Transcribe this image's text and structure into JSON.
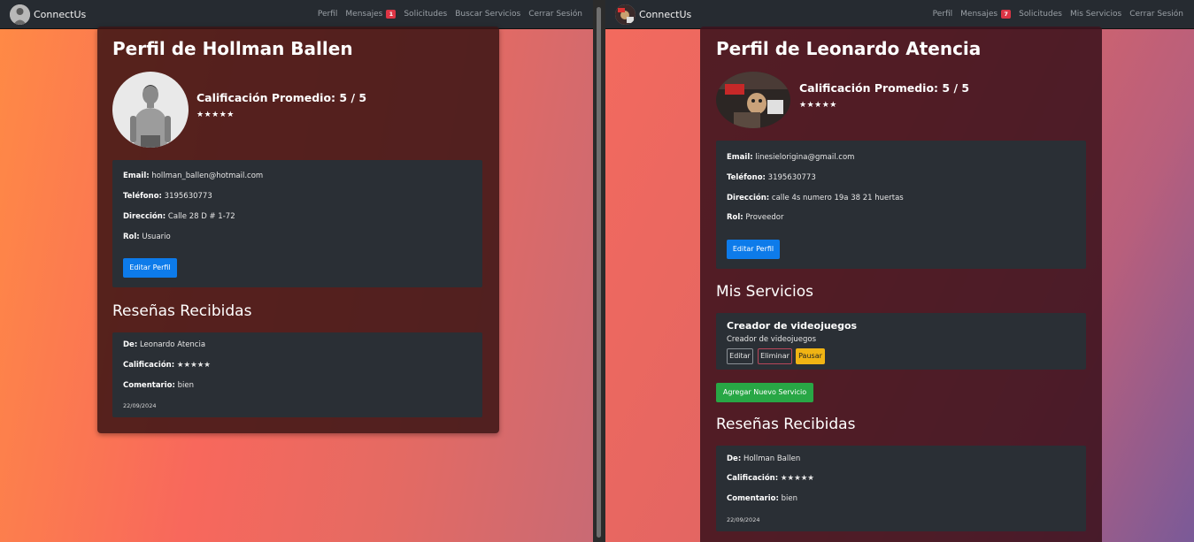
{
  "left": {
    "navbar": {
      "brand": "ConnectUs",
      "links": [
        "Perfil",
        "Mensajes",
        "Solicitudes",
        "Buscar Servicios",
        "Cerrar Sesión"
      ],
      "messages_badge": "1"
    },
    "profile": {
      "title": "Perfil de Hollman Ballen",
      "rating_label": "Calificación Promedio: 5 / 5",
      "stars": "★★★★★",
      "email_label": "Email:",
      "email": "hollman_ballen@hotmail.com",
      "phone_label": "Teléfono:",
      "phone": "3195630773",
      "address_label": "Dirección:",
      "address": "Calle 28 D # 1-72",
      "role_label": "Rol:",
      "role": "Usuario",
      "edit_button": "Editar Perfil"
    },
    "reviews": {
      "title": "Reseñas Recibidas",
      "items": [
        {
          "from_label": "De:",
          "from": "Leonardo Atencia",
          "rating_label": "Calificación:",
          "rating": "★★★★★",
          "comment_label": "Comentario:",
          "comment": "bien",
          "date": "22/09/2024"
        }
      ]
    }
  },
  "right": {
    "navbar": {
      "brand": "ConnectUs",
      "links": [
        "Perfil",
        "Mensajes",
        "Solicitudes",
        "Mis Servicios",
        "Cerrar Sesión"
      ],
      "messages_badge": "7"
    },
    "profile": {
      "title": "Perfil de Leonardo Atencia",
      "rating_label": "Calificación Promedio: 5 / 5",
      "stars": "★★★★★",
      "email_label": "Email:",
      "email": "linesielorigina@gmail.com",
      "phone_label": "Teléfono:",
      "phone": "3195630773",
      "address_label": "Dirección:",
      "address": "calle 4s numero 19a 38 21 huertas",
      "role_label": "Rol:",
      "role": "Proveedor",
      "edit_button": "Editar Perfil"
    },
    "services": {
      "title": "Mis Servicios",
      "items": [
        {
          "name": "Creador de videojuegos",
          "description": "Creador de videojuegos",
          "edit": "Editar",
          "delete": "Eliminar",
          "pause": "Pausar"
        }
      ],
      "add_button": "Agregar Nuevo Servicio"
    },
    "reviews": {
      "title": "Reseñas Recibidas",
      "items": [
        {
          "from_label": "De:",
          "from": "Hollman Ballen",
          "rating_label": "Calificación:",
          "rating": "★★★★★",
          "comment_label": "Comentario:",
          "comment": "bien",
          "date": "22/09/2024"
        }
      ]
    }
  },
  "colors": {
    "navbar_bg": "#262b31",
    "primary": "#0d7bea",
    "success": "#28a745",
    "warning": "#f0b414",
    "danger_badge": "#dc3545"
  }
}
